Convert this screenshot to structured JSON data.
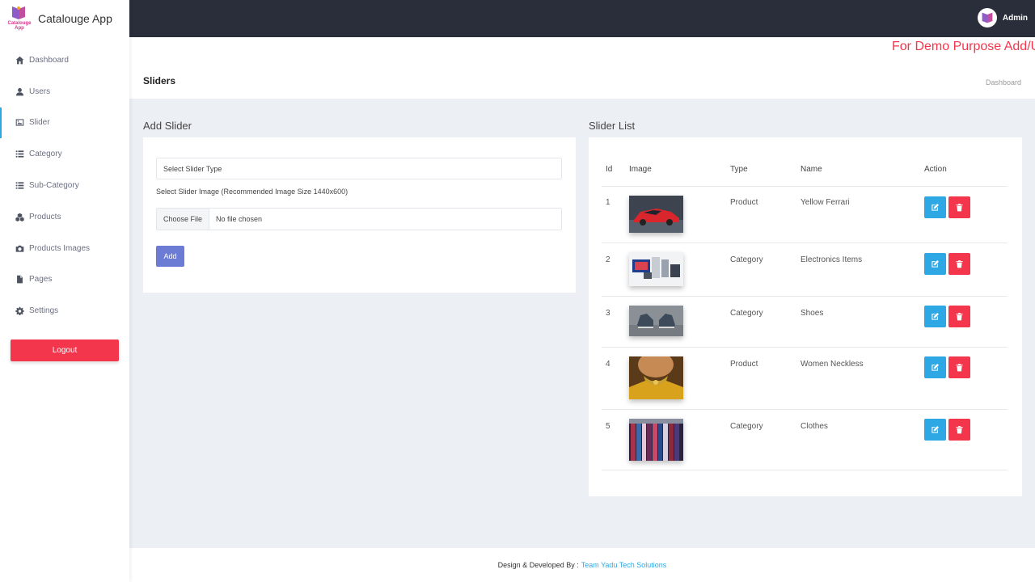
{
  "brand": {
    "name": "Catalouge App",
    "logo_text": "Catalouge App"
  },
  "sidebar": {
    "items": [
      {
        "label": "Dashboard",
        "icon": "home-icon"
      },
      {
        "label": "Users",
        "icon": "user-icon"
      },
      {
        "label": "Slider",
        "icon": "image-icon",
        "active": true
      },
      {
        "label": "Category",
        "icon": "list-icon"
      },
      {
        "label": "Sub-Category",
        "icon": "list-icon"
      },
      {
        "label": "Products",
        "icon": "cubes-icon"
      },
      {
        "label": "Products Images",
        "icon": "camera-icon"
      },
      {
        "label": "Pages",
        "icon": "file-icon"
      },
      {
        "label": "Settings",
        "icon": "gear-icon"
      }
    ],
    "logout_label": "Logout"
  },
  "topbar": {
    "user_name": "Admin"
  },
  "header": {
    "demo_text": "For Demo Purpose Add/U",
    "page_title": "Sliders",
    "breadcrumb": "Dashboard"
  },
  "add_slider": {
    "title": "Add Slider",
    "select_placeholder": "Select Slider Type",
    "image_label": "Select Slider Image (Recommended Image Size 1440x600)",
    "choose_file_label": "Choose File",
    "no_file_text": "No file chosen",
    "add_label": "Add"
  },
  "slider_list": {
    "title": "Slider List",
    "columns": [
      "Id",
      "Image",
      "Type",
      "Name",
      "Action"
    ],
    "rows": [
      {
        "id": "1",
        "type": "Product",
        "name": "Yellow Ferrari",
        "thumb": "car-image"
      },
      {
        "id": "2",
        "type": "Category",
        "name": "Electronics Items",
        "thumb": "electronics-image"
      },
      {
        "id": "3",
        "type": "Category",
        "name": "Shoes",
        "thumb": "shoes-image"
      },
      {
        "id": "4",
        "type": "Product",
        "name": "Women Neckless",
        "thumb": "necklace-image"
      },
      {
        "id": "5",
        "type": "Category",
        "name": "Clothes",
        "thumb": "clothes-image"
      }
    ]
  },
  "footer": {
    "prefix": "Design & Developed By :",
    "link_text": "Team Yadu Tech Solutions"
  },
  "colors": {
    "topbar": "#2a2d3a",
    "accent_blue": "#2ea8e5",
    "danger": "#f4364c",
    "primary_button": "#6c7bd4",
    "background": "#ecf0f5"
  }
}
